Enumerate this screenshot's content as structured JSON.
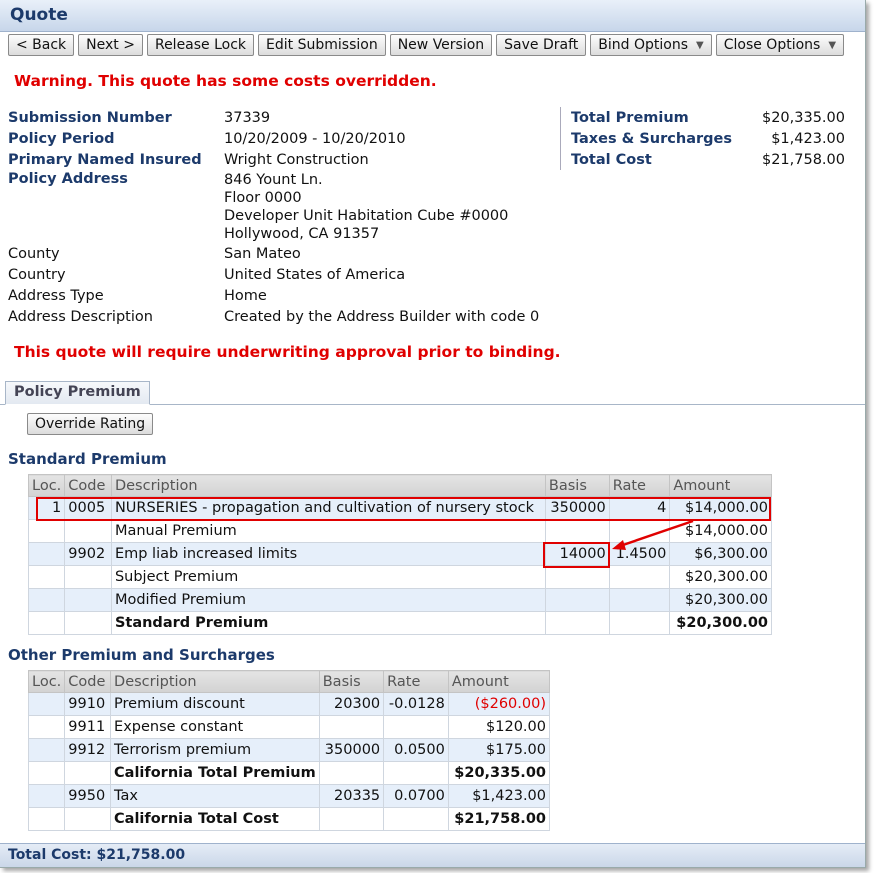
{
  "window": {
    "title": "Quote"
  },
  "toolbar": {
    "back": "< Back",
    "next": "Next >",
    "release_lock": "Release Lock",
    "edit_submission": "Edit Submission",
    "new_version": "New Version",
    "save_draft": "Save Draft",
    "bind_options": "Bind Options",
    "close_options": "Close Options"
  },
  "warning": "Warning. This quote has some costs overridden.",
  "details": {
    "submission_number_label": "Submission Number",
    "submission_number": "37339",
    "policy_period_label": "Policy Period",
    "policy_period": "10/20/2009 - 10/20/2010",
    "primary_insured_label": "Primary Named Insured",
    "primary_insured": "Wright Construction",
    "policy_address_label": "Policy Address",
    "address_lines": [
      "846 Yount Ln.",
      "Floor 0000",
      "Developer Unit Habitation Cube #0000",
      "Hollywood, CA 91357"
    ],
    "county_label": "County",
    "county": "San Mateo",
    "country_label": "Country",
    "country": "United States of America",
    "address_type_label": "Address Type",
    "address_type": "Home",
    "address_desc_label": "Address Description",
    "address_desc": "Created by the Address Builder with code 0"
  },
  "totals": {
    "total_premium_label": "Total Premium",
    "total_premium": "$20,335.00",
    "taxes_label": "Taxes & Surcharges",
    "taxes": "$1,423.00",
    "total_cost_label": "Total Cost",
    "total_cost": "$21,758.00"
  },
  "approval_warning": "This quote will require underwriting approval prior to binding.",
  "tab": {
    "label": "Policy Premium"
  },
  "override_button": "Override Rating",
  "standard": {
    "title": "Standard Premium",
    "headers": [
      "Loc.",
      "Code",
      "Description",
      "Basis",
      "Rate",
      "Amount"
    ],
    "rows": [
      [
        "1",
        "0005",
        "NURSERIES - propagation and cultivation of nursery stock",
        "350000",
        "4",
        "$14,000.00"
      ],
      [
        "",
        "",
        "Manual Premium",
        "",
        "",
        "$14,000.00"
      ],
      [
        "",
        "9902",
        "Emp liab increased limits",
        "14000",
        "1.4500",
        "$6,300.00"
      ],
      [
        "",
        "",
        "Subject Premium",
        "",
        "",
        "$20,300.00"
      ],
      [
        "",
        "",
        "Modified Premium",
        "",
        "",
        "$20,300.00"
      ],
      [
        "",
        "",
        "Standard Premium",
        "",
        "",
        "$20,300.00"
      ]
    ]
  },
  "other": {
    "title": "Other Premium and Surcharges",
    "headers": [
      "Loc.",
      "Code",
      "Description",
      "Basis",
      "Rate",
      "Amount"
    ],
    "rows": [
      [
        "",
        "9910",
        "Premium discount",
        "20300",
        "-0.0128",
        "($260.00)"
      ],
      [
        "",
        "9911",
        "Expense constant",
        "",
        "",
        "$120.00"
      ],
      [
        "",
        "9912",
        "Terrorism premium",
        "350000",
        "0.0500",
        "$175.00"
      ],
      [
        "",
        "",
        "California Total Premium",
        "",
        "",
        "$20,335.00"
      ],
      [
        "",
        "9950",
        "Tax",
        "20335",
        "0.0700",
        "$1,423.00"
      ],
      [
        "",
        "",
        "California Total Cost",
        "",
        "",
        "$21,758.00"
      ]
    ]
  },
  "footer": {
    "total_cost": "Total Cost: $21,758.00"
  },
  "colors": {
    "warning": "#e00000",
    "label": "#1c3a6b",
    "row_alt": "#e6effa",
    "header_bar": "#c7d6ea"
  }
}
